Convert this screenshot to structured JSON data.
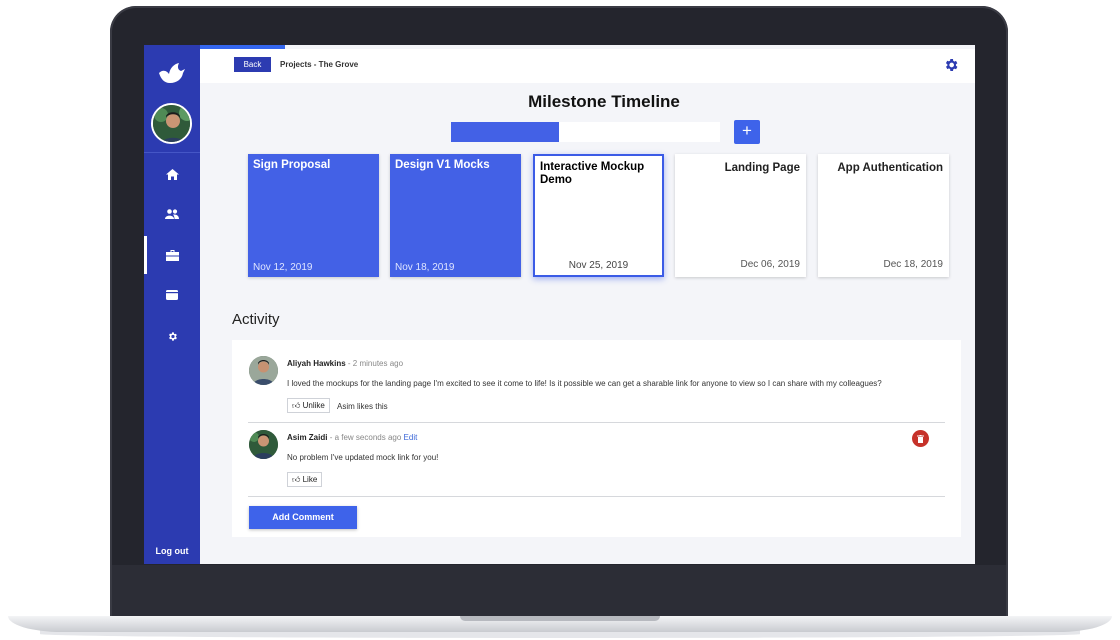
{
  "sidebar": {
    "items": [
      {
        "icon": "home-icon",
        "active": false
      },
      {
        "icon": "users-icon",
        "active": false
      },
      {
        "icon": "briefcase-icon",
        "active": true
      },
      {
        "icon": "wallet-icon",
        "active": false
      },
      {
        "icon": "gear-icon",
        "active": false
      }
    ],
    "logout_label": "Log out"
  },
  "topbar": {
    "back_label": "Back",
    "breadcrumb": "Projects - The Grove"
  },
  "main": {
    "title": "Milestone Timeline",
    "search_progress": 0.4,
    "add_label": "+"
  },
  "milestones": [
    {
      "title": "Sign Proposal",
      "date": "Nov 12, 2019",
      "state": "done"
    },
    {
      "title": "Design V1 Mocks",
      "date": "Nov 18, 2019",
      "state": "done"
    },
    {
      "title": "Interactive Mockup Demo",
      "date": "Nov 25, 2019",
      "state": "current"
    },
    {
      "title": "Landing Page",
      "date": "Dec 06, 2019",
      "state": "upcoming"
    },
    {
      "title": "App Authentication",
      "date": "Dec 18, 2019",
      "state": "upcoming"
    }
  ],
  "activity": {
    "title": "Activity",
    "comments": [
      {
        "author": "Aliyah Hawkins",
        "time": "- 2 minutes ago",
        "edit": "",
        "body": "I loved the mockups for the landing page I'm excited to see it come to life! Is it possible we can get a sharable link for anyone to view so I can share with my colleagues?",
        "like_label": "Unlike",
        "likes_text": "Asim likes this"
      },
      {
        "author": "Asim Zaidi",
        "time": "- a few seconds ago",
        "edit": "Edit",
        "body": "No problem I've updated mock link for you!",
        "like_label": "Like",
        "likes_text": ""
      }
    ],
    "add_comment_label": "Add Comment"
  },
  "colors": {
    "sidebar": "#2c3bb1",
    "accent": "#3e63ea",
    "milestone_done": "#4361e6",
    "delete": "#c6322a"
  }
}
